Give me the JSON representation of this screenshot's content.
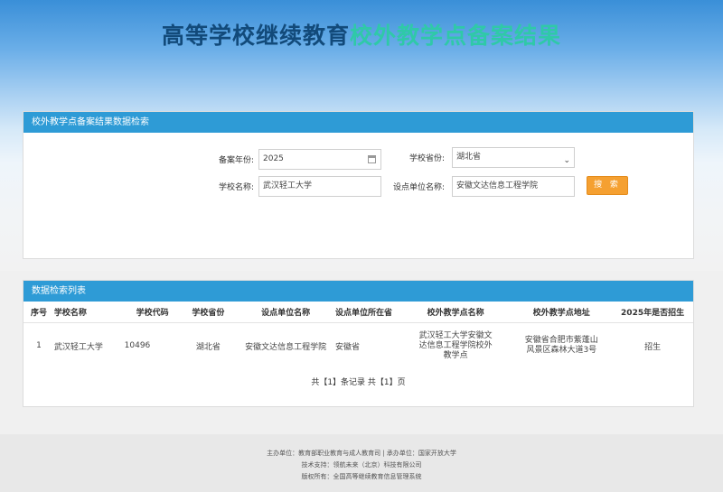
{
  "page_title": {
    "part1": "高等学校继续教育",
    "part2": "校外教学点备案结果"
  },
  "search": {
    "header": "校外教学点备案结果数据检索",
    "year_label": "备案年份:",
    "year_value": "2025",
    "province_label": "学校省份:",
    "province_value": "湖北省",
    "school_label": "学校名称:",
    "school_value": "武汉轻工大学",
    "unit_label": "设点单位名称:",
    "unit_value": "安徽文达信息工程学院",
    "search_button": "搜 索"
  },
  "results": {
    "header": "数据检索列表",
    "columns": [
      "序号",
      "学校名称",
      "学校代码",
      "学校省份",
      "设点单位名称",
      "设点单位所在省",
      "校外教学点名称",
      "校外教学点地址",
      "2025年是否招生"
    ],
    "rows": [
      {
        "index": "1",
        "school": "武汉轻工大学",
        "code": "10496",
        "province": "湖北省",
        "unit": "安徽文达信息工程学院",
        "unit_province": "安徽省",
        "site_name": "武汉轻工大学安徽文达信息工程学院校外教学点",
        "site_address": "安徽省合肥市紫蓬山风景区森林大道3号",
        "enroll": "招生"
      }
    ],
    "pager": "共【1】条记录 共【1】页"
  },
  "footer": {
    "line1": "主办单位：教育部职业教育与成人教育司 | 承办单位：国家开放大学",
    "line2": "技术支持：领航未来（北京）科技有限公司",
    "line3": "版权所有：全国高等继续教育信息管理系统"
  }
}
